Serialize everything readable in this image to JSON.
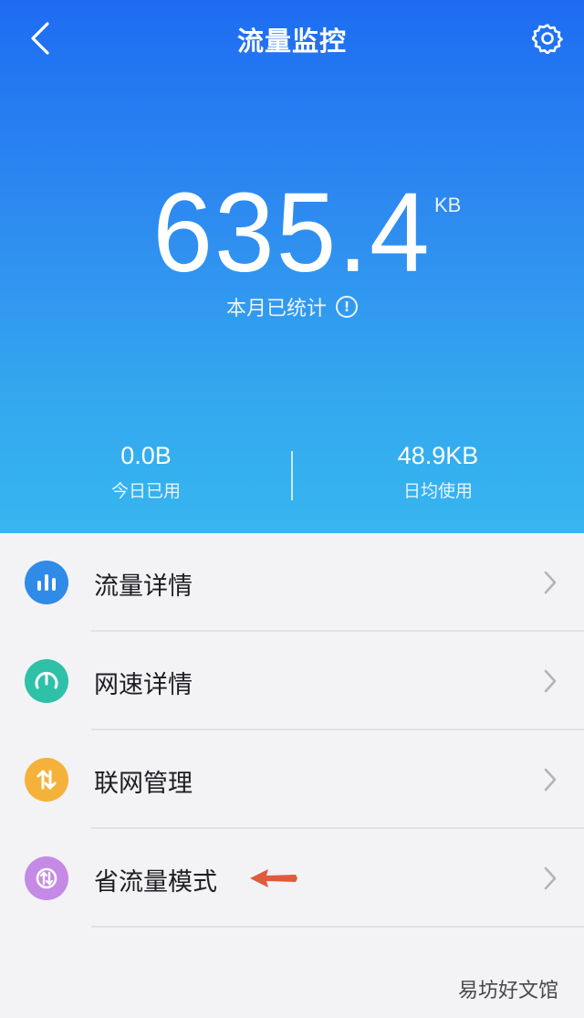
{
  "header": {
    "title": "流量监控",
    "back_icon": "chevron-left-icon",
    "settings_icon": "gear-icon"
  },
  "summary": {
    "value": "635.4",
    "unit": "KB",
    "label": "本月已统计",
    "info_icon": "info-icon"
  },
  "stats": {
    "today": {
      "value": "0.0B",
      "label": "今日已用"
    },
    "daily_avg": {
      "value": "48.9KB",
      "label": "日均使用"
    }
  },
  "menu": [
    {
      "label": "流量详情",
      "icon": "bar-chart-icon",
      "color": "#2f8ae8"
    },
    {
      "label": "网速详情",
      "icon": "speedometer-icon",
      "color": "#2fc0a8"
    },
    {
      "label": "联网管理",
      "icon": "up-down-arrows-icon",
      "color": "#f5b23a"
    },
    {
      "label": "省流量模式",
      "icon": "data-saver-icon",
      "color": "#c48ae6"
    }
  ],
  "watermark": "易坊好文馆",
  "colors": {
    "hero_top": "#1e6cf2",
    "hero_bottom": "#36b6ef",
    "annotation_arrow": "#e05a3c"
  }
}
